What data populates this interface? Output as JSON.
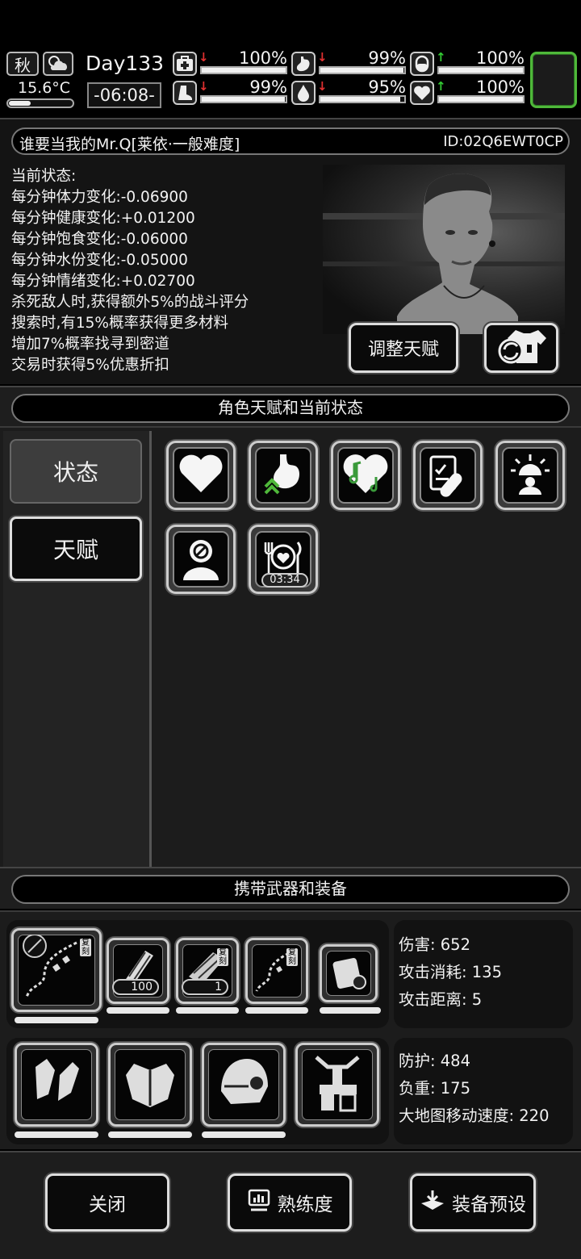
{
  "topbar": {
    "season": "秋",
    "temperature": "15.6°C",
    "thermometer_level": 0.35,
    "day": "Day133",
    "clock": "-06:08-",
    "stats": [
      {
        "icon": "first-aid-icon",
        "trend": "down",
        "trend_color": "#e03030",
        "value": "100%",
        "level": 1.0
      },
      {
        "icon": "stomach-icon",
        "trend": "down",
        "trend_color": "#e03030",
        "value": "99%",
        "level": 0.99
      },
      {
        "icon": "pill-icon",
        "trend": "up",
        "trend_color": "#33cc33",
        "value": "100%",
        "level": 1.0
      },
      {
        "icon": "boot-icon",
        "trend": "down",
        "trend_color": "#e03030",
        "value": "99%",
        "level": 0.99
      },
      {
        "icon": "water-drop-icon",
        "trend": "down",
        "trend_color": "#e03030",
        "value": "95%",
        "level": 0.95
      },
      {
        "icon": "heart-icon",
        "trend": "up",
        "trend_color": "#33cc33",
        "value": "100%",
        "level": 1.0
      }
    ],
    "accent_green": "#4fb83a"
  },
  "character": {
    "title": "谁要当我的Mr.Q[莱依·一般难度]",
    "id": "ID:02Q6EWT0CP",
    "state_heading": "当前状态:",
    "state_lines": [
      "每分钟体力变化:-0.06900",
      "每分钟健康变化:+0.01200",
      "每分钟饱食变化:-0.06000",
      "每分钟水份变化:-0.05000",
      "每分钟情绪变化:+0.02700",
      "杀死敌人时,获得额外5%的战斗评分",
      "搜索时,有15%概率获得更多材料",
      "增加7%概率找寻到密道",
      "交易时获得5%优惠折扣"
    ],
    "adjust_button": "调整天赋"
  },
  "talent_section": {
    "header": "角色天赋和当前状态",
    "tabs": {
      "status": "状态",
      "talent": "天赋"
    },
    "effects": [
      {
        "icon": "heart-icon"
      },
      {
        "icon": "stomach-arrow-icon"
      },
      {
        "icon": "music-heart-icon"
      },
      {
        "icon": "medicine-icon"
      },
      {
        "icon": "alarm-person-icon"
      },
      {
        "icon": "no-smoking-person-icon"
      },
      {
        "icon": "meal-icon",
        "timer": "03:34"
      }
    ]
  },
  "equipment_section": {
    "header": "携带武器和装备",
    "weapon_stats": [
      "伤害: 652",
      "攻击消耗: 135",
      "攻击距离: 5"
    ],
    "armor_stats": [
      "防护: 484",
      "负重: 175",
      "大地图移动速度: 220"
    ],
    "weapons": [
      {
        "icon": "chain-whip-icon",
        "tag": "复刻"
      },
      {
        "icon": "minigun-icon",
        "count": "100"
      },
      {
        "icon": "mech-arm-icon",
        "tag": "复刻",
        "count": "1"
      },
      {
        "icon": "chain-whip-icon",
        "tag": "复刻"
      },
      {
        "icon": "backpack-icon"
      }
    ],
    "armor": [
      {
        "icon": "gloves-icon"
      },
      {
        "icon": "chest-armor-icon"
      },
      {
        "icon": "helmet-icon"
      },
      {
        "icon": "power-armor-legs-icon"
      }
    ]
  },
  "bottom": {
    "close": "关闭",
    "proficiency": "熟练度",
    "preset": "装备预设"
  }
}
